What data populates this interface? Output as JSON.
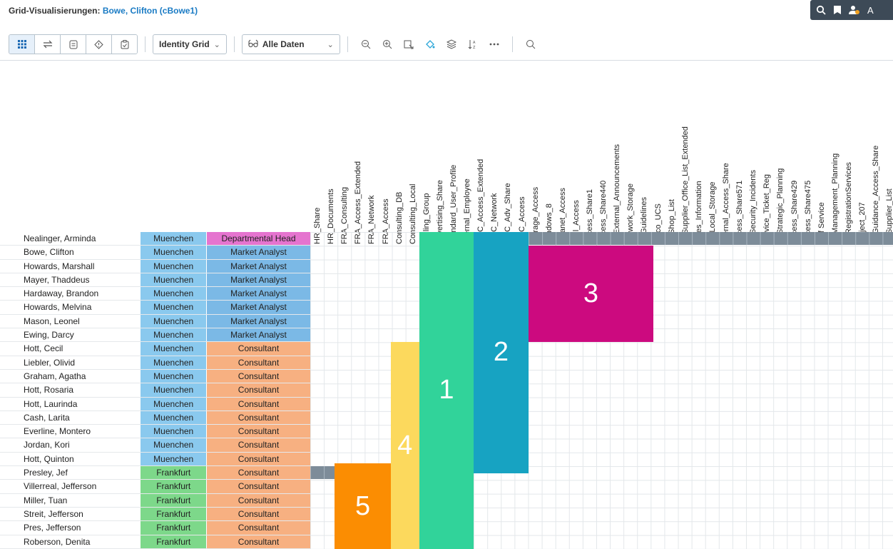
{
  "header": {
    "title_prefix": "Grid-Visualisierungen: ",
    "title_user": "Bowe, Clifton (cBowe1)",
    "right_letter": "A"
  },
  "toolbar": {
    "view_dropdown": "Identity Grid",
    "data_dropdown": "Alle Daten"
  },
  "columns": [
    "HR_Share",
    "HR_Documents",
    "FRA_Consulting",
    "FRA_Access_Extended",
    "FRA_Network",
    "FRA_Access",
    "Consulting_DB",
    "Consulting_Local",
    "Mailing_Group",
    "Advertising_Share",
    "Standard_User_Profile",
    "Internal_Employee",
    "MUC_Access_Extended",
    "MUC_Network",
    "MUC_Adv_Share",
    "MUC_Access",
    "Storage_Access",
    "Windows_8",
    "Intranet_Access",
    "Mail_Access",
    "Access_Share1",
    "Access_Share440",
    "R_External_Announcements",
    "Network_Storage",
    "R_Guidelines",
    "Cisco_UCS",
    "R_Shop_List",
    "R_Supplier_Office_List_Extended",
    "Sales_Information",
    "W_Local_Storage",
    "Internal_Access_Share",
    "Access_Share571",
    "R_Security_Incidents",
    "Service_Ticket_Reg",
    "R_Strategic_Planning",
    "Access_Share429",
    "Access_Share475",
    "Self Service",
    "R_Management_Planning",
    "R_RegistrationServices",
    "Project_207",
    "R_Guidance_Access_Share",
    "R_Supplier_List"
  ],
  "rows": [
    {
      "name": "Nealinger, Arminda",
      "location": "Muenchen",
      "role": "Departmental Head"
    },
    {
      "name": "Bowe, Clifton",
      "location": "Muenchen",
      "role": "Market Analyst"
    },
    {
      "name": "Howards, Marshall",
      "location": "Muenchen",
      "role": "Market Analyst"
    },
    {
      "name": "Mayer, Thaddeus",
      "location": "Muenchen",
      "role": "Market Analyst"
    },
    {
      "name": "Hardaway, Brandon",
      "location": "Muenchen",
      "role": "Market Analyst"
    },
    {
      "name": "Howards, Melvina",
      "location": "Muenchen",
      "role": "Market Analyst"
    },
    {
      "name": "Mason, Leonel",
      "location": "Muenchen",
      "role": "Market Analyst"
    },
    {
      "name": "Ewing, Darcy",
      "location": "Muenchen",
      "role": "Market Analyst"
    },
    {
      "name": "Hott, Cecil",
      "location": "Muenchen",
      "role": "Consultant"
    },
    {
      "name": "Liebler, Olivid",
      "location": "Muenchen",
      "role": "Consultant"
    },
    {
      "name": "Graham, Agatha",
      "location": "Muenchen",
      "role": "Consultant"
    },
    {
      "name": "Hott, Rosaria",
      "location": "Muenchen",
      "role": "Consultant"
    },
    {
      "name": "Hott, Laurinda",
      "location": "Muenchen",
      "role": "Consultant"
    },
    {
      "name": "Cash, Larita",
      "location": "Muenchen",
      "role": "Consultant"
    },
    {
      "name": "Everline, Montero",
      "location": "Muenchen",
      "role": "Consultant"
    },
    {
      "name": "Jordan, Kori",
      "location": "Muenchen",
      "role": "Consultant"
    },
    {
      "name": "Hott, Quinton",
      "location": "Muenchen",
      "role": "Consultant"
    },
    {
      "name": "Presley, Jef",
      "location": "Frankfurt",
      "role": "Consultant"
    },
    {
      "name": "Villerreal, Jefferson",
      "location": "Frankfurt",
      "role": "Consultant"
    },
    {
      "name": "Miller, Tuan",
      "location": "Frankfurt",
      "role": "Consultant"
    },
    {
      "name": "Streit, Jefferson",
      "location": "Frankfurt",
      "role": "Consultant"
    },
    {
      "name": "Pres, Jefferson",
      "location": "Frankfurt",
      "role": "Consultant"
    },
    {
      "name": "Roberson, Denita",
      "location": "Frankfurt",
      "role": "Consultant"
    }
  ],
  "blocks": [
    {
      "label": "1",
      "color": "#31d39a"
    },
    {
      "label": "2",
      "color": "#17a3c2"
    },
    {
      "label": "3",
      "color": "#cc0a7f"
    },
    {
      "label": "4",
      "color": "#fcd95d"
    },
    {
      "label": "5",
      "color": "#fb8d02"
    }
  ]
}
